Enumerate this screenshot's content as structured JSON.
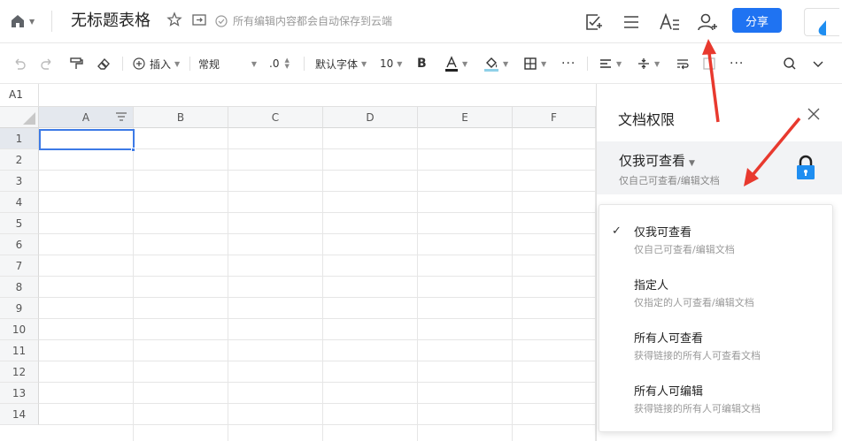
{
  "topbar": {
    "doc_title": "无标题表格",
    "save_status": "所有编辑内容都会自动保存到云端",
    "share_label": "分享"
  },
  "toolbar": {
    "insert_label": "插入",
    "format_label": "常规",
    "decimal_label": ".0",
    "font_label": "默认字体",
    "size_label": "10"
  },
  "formula_bar": {
    "cell_ref": "A1"
  },
  "grid": {
    "columns": [
      "A",
      "B",
      "C",
      "D",
      "E",
      "F"
    ],
    "rows": [
      "1",
      "2",
      "3",
      "4",
      "5",
      "6",
      "7",
      "8",
      "9",
      "10",
      "11",
      "12",
      "13",
      "14"
    ],
    "active_cell": "A1"
  },
  "panel": {
    "title": "文档权限",
    "current_label": "仅我可查看",
    "current_desc": "仅自己可查看/编辑文档",
    "options": [
      {
        "name": "仅我可查看",
        "desc": "仅自己可查看/编辑文档",
        "checked": true
      },
      {
        "name": "指定人",
        "desc": "仅指定的人可查看/编辑文档",
        "checked": false
      },
      {
        "name": "所有人可查看",
        "desc": "获得链接的所有人可查看文档",
        "checked": false
      },
      {
        "name": "所有人可编辑",
        "desc": "获得链接的所有人可编辑文档",
        "checked": false
      }
    ],
    "check_mark": "✓"
  },
  "colors": {
    "accent": "#1f73f2",
    "arrow": "#e8392e",
    "selection": "#3d7ae6"
  }
}
